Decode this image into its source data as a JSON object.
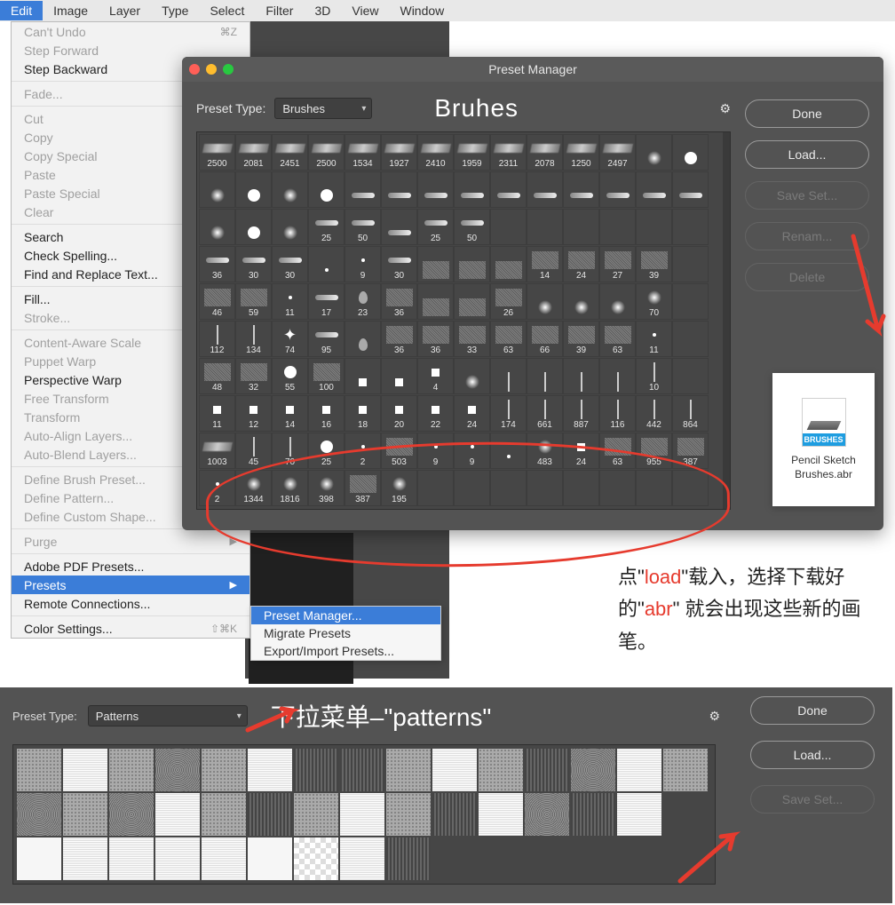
{
  "menubar": [
    "Edit",
    "Image",
    "Layer",
    "Type",
    "Select",
    "Filter",
    "3D",
    "View",
    "Window"
  ],
  "edit_menu": [
    {
      "label": "Can't Undo",
      "shortcut": "⌘Z",
      "disabled": true
    },
    {
      "label": "Step Forward",
      "disabled": true
    },
    {
      "label": "Step Backward"
    },
    "sep",
    {
      "label": "Fade...",
      "disabled": true
    },
    "sep",
    {
      "label": "Cut",
      "disabled": true
    },
    {
      "label": "Copy",
      "disabled": true
    },
    {
      "label": "Copy Special",
      "arrow": true,
      "disabled": true
    },
    {
      "label": "Paste",
      "disabled": true
    },
    {
      "label": "Paste Special",
      "arrow": true,
      "disabled": true
    },
    {
      "label": "Clear",
      "disabled": true
    },
    "sep",
    {
      "label": "Search"
    },
    {
      "label": "Check Spelling..."
    },
    {
      "label": "Find and Replace Text..."
    },
    "sep",
    {
      "label": "Fill..."
    },
    {
      "label": "Stroke...",
      "disabled": true
    },
    "sep",
    {
      "label": "Content-Aware Scale",
      "disabled": true
    },
    {
      "label": "Puppet Warp",
      "disabled": true
    },
    {
      "label": "Perspective Warp"
    },
    {
      "label": "Free Transform",
      "disabled": true
    },
    {
      "label": "Transform",
      "arrow": true,
      "disabled": true
    },
    {
      "label": "Auto-Align Layers...",
      "disabled": true
    },
    {
      "label": "Auto-Blend Layers...",
      "disabled": true
    },
    "sep",
    {
      "label": "Define Brush Preset...",
      "disabled": true
    },
    {
      "label": "Define Pattern...",
      "disabled": true
    },
    {
      "label": "Define Custom Shape...",
      "disabled": true
    },
    "sep",
    {
      "label": "Purge",
      "arrow": true,
      "disabled": true
    },
    "sep",
    {
      "label": "Adobe PDF Presets..."
    },
    {
      "label": "Presets",
      "arrow": true,
      "hover": true
    },
    {
      "label": "Remote Connections..."
    },
    "sep",
    {
      "label": "Color Settings...",
      "shortcut": "⇧⌘K"
    }
  ],
  "presets_submenu": [
    {
      "label": "Preset Manager...",
      "hover": true
    },
    {
      "label": "Migrate Presets"
    },
    {
      "label": "Export/Import Presets..."
    }
  ],
  "preset_manager": {
    "title": "Preset Manager",
    "type_label": "Preset Type:",
    "type_value": "Brushes",
    "annotation": "Bruhes",
    "buttons": {
      "done": "Done",
      "load": "Load...",
      "save_set": "Save Set...",
      "rename": "Renam...",
      "delete": "Delete"
    }
  },
  "brush_values": [
    "2500",
    "2081",
    "2451",
    "2500",
    "1534",
    "1927",
    "2410",
    "1959",
    "2311",
    "2078",
    "1250",
    "2497",
    "",
    "",
    "",
    "",
    "",
    "",
    "",
    "",
    "",
    "",
    "",
    "",
    "",
    "",
    "",
    "",
    "",
    "",
    "",
    "25",
    "50",
    "",
    "25",
    "50",
    "",
    "",
    "",
    "",
    "",
    "",
    "36",
    "30",
    "30",
    "",
    "9",
    "30",
    "",
    "",
    "",
    "14",
    "24",
    "27",
    "39",
    "",
    "46",
    "59",
    "11",
    "17",
    "23",
    "36",
    "",
    "",
    "26",
    "",
    "",
    "",
    "70",
    "",
    "112",
    "134",
    "74",
    "95",
    "",
    "36",
    "36",
    "33",
    "63",
    "66",
    "39",
    "63",
    "11",
    "",
    "48",
    "32",
    "55",
    "100",
    "",
    "",
    "4",
    "",
    "",
    "",
    "",
    "",
    "10",
    "",
    "11",
    "12",
    "14",
    "16",
    "18",
    "20",
    "22",
    "24",
    "174",
    "661",
    "887",
    "116",
    "442",
    "864",
    "1003",
    "45",
    "70",
    "25",
    "2",
    "503",
    "9",
    "9",
    "",
    "483",
    "24",
    "63",
    "955",
    "387",
    "2",
    "1344",
    "1816",
    "398",
    "387",
    "195",
    "",
    "",
    "",
    "",
    "",
    "",
    "",
    ""
  ],
  "brush_types": [
    "stroke",
    "stroke",
    "stroke",
    "stroke",
    "stroke",
    "stroke",
    "stroke",
    "stroke",
    "stroke",
    "stroke",
    "stroke",
    "stroke",
    "soft",
    "hard",
    "soft",
    "hard",
    "soft",
    "hard",
    "tip",
    "tip",
    "tip",
    "tip",
    "tip",
    "tip",
    "tip",
    "tip",
    "tip",
    "tip",
    "soft",
    "hard",
    "soft",
    "tip",
    "tip",
    "tip",
    "tip",
    "tip",
    "",
    "",
    "",
    "",
    "",
    "",
    "tip",
    "tip",
    "tip",
    "dot",
    "dot",
    "tip",
    "tex",
    "tex",
    "tex",
    "tex",
    "tex",
    "tex",
    "tex",
    "",
    "tex",
    "tex",
    "dot",
    "tip",
    "drop",
    "tex",
    "tex",
    "tex",
    "tex",
    "soft",
    "soft",
    "soft",
    "soft",
    "",
    "line",
    "line",
    "star",
    "tip",
    "drop",
    "tex",
    "tex",
    "tex",
    "tex",
    "tex",
    "tex",
    "tex",
    "dot",
    "",
    "tex",
    "tex",
    "hard",
    "tex",
    "square",
    "square",
    "square",
    "soft",
    "line",
    "line",
    "line",
    "line",
    "line",
    "",
    "square",
    "square",
    "square",
    "square",
    "square",
    "square",
    "square",
    "square",
    "line",
    "line",
    "line",
    "line",
    "line",
    "line",
    "stroke",
    "line",
    "line",
    "hard",
    "dot",
    "tex",
    "dot",
    "dot",
    "dot",
    "soft",
    "square",
    "tex",
    "tex",
    "tex",
    "dot",
    "soft",
    "soft",
    "soft",
    "tex",
    "soft",
    "",
    "",
    "",
    "",
    "",
    "",
    "",
    ""
  ],
  "abr_file": {
    "icon_bar": "BRUSHES",
    "name": "Pencil Sketch Brushes.abr"
  },
  "annotation_cn": {
    "p1a": "点\"",
    "p1b": "load",
    "p1c": "\"载入，选择下载好的\"",
    "p1d": "abr",
    "p1e": "\" 就会出现这些新的画笔。"
  },
  "patterns_panel": {
    "type_label": "Preset Type:",
    "type_value": "Patterns",
    "annotation": "下拉菜单–\"patterns\"",
    "buttons": {
      "done": "Done",
      "load": "Load...",
      "save_set": "Save Set..."
    }
  },
  "pattern_styles": [
    "mid",
    "light",
    "mid",
    "noise",
    "mid",
    "light",
    "dark",
    "dark",
    "mid",
    "light",
    "mid",
    "dark",
    "noise",
    "light",
    "mid",
    "noise",
    "mid",
    "noise",
    "light",
    "mid",
    "dark",
    "mid",
    "light",
    "mid",
    "dark",
    "light",
    "noise",
    "dark",
    "light",
    "",
    "white",
    "light",
    "light",
    "light",
    "light",
    "white",
    "check",
    "light",
    "dark",
    "",
    "",
    "",
    "",
    "",
    ""
  ]
}
